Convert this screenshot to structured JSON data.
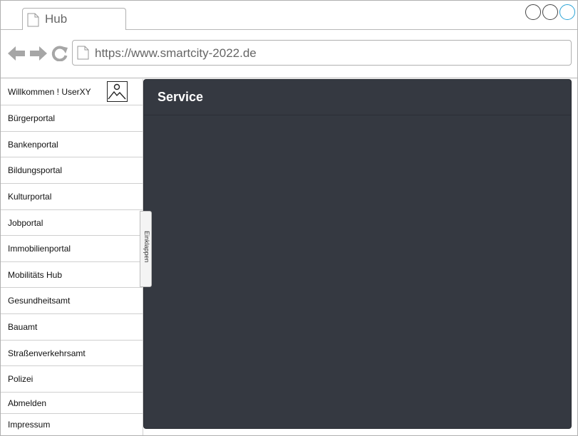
{
  "browser": {
    "tab_title": "Hub",
    "url": "https://www.smartcity-2022.de"
  },
  "sidebar": {
    "welcome": "Willkommen ! UserXY",
    "items": [
      {
        "label": "Bürgerportal"
      },
      {
        "label": "Bankenportal"
      },
      {
        "label": "Bildungsportal"
      },
      {
        "label": "Kulturportal"
      },
      {
        "label": "Jobportal"
      },
      {
        "label": "Immobilienportal"
      },
      {
        "label": "Mobilitäts Hub"
      },
      {
        "label": "Gesundheitsamt"
      },
      {
        "label": "Bauamt"
      },
      {
        "label": "Straßenverkehrsamt"
      },
      {
        "label": "Polizei"
      }
    ],
    "logout": "Abmelden",
    "imprint": "Impressum",
    "collapse_label": "Einklappen"
  },
  "main": {
    "title": "Service"
  },
  "colors": {
    "panel_bg": "#353941",
    "window_control_active": "#29a3d6"
  }
}
